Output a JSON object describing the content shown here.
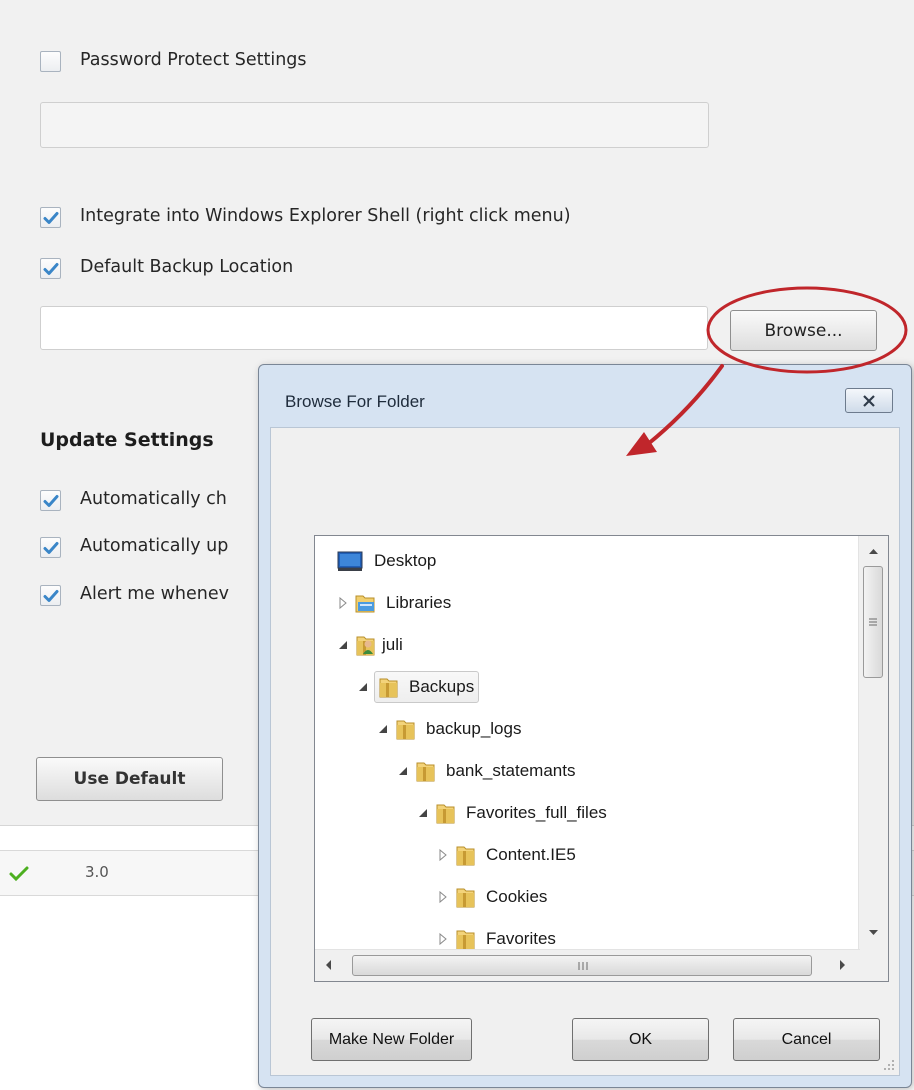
{
  "settings": {
    "password_protect_label": "Password Protect Settings",
    "integrate_shell_label": "Integrate into Windows Explorer Shell (right click menu)",
    "default_backup_label": "Default Backup Location",
    "browse_button": "Browse...",
    "update_heading": "Update Settings",
    "auto_check_label": "Automatically ch",
    "auto_update_label": "Automatically up",
    "alert_label": "Alert me whenev",
    "use_default_button": "Use Default",
    "checkboxes": {
      "password_protect": false,
      "integrate_shell": true,
      "default_backup": true,
      "auto_check": true,
      "auto_update": true,
      "alert": true
    }
  },
  "status_bar": {
    "version": "3.0"
  },
  "dialog": {
    "title": "Browse For Folder",
    "tree": [
      {
        "label": "Desktop",
        "icon": "desktop-icon",
        "expander": "none"
      },
      {
        "label": "Libraries",
        "icon": "libraries-icon",
        "expander": "collapsed"
      },
      {
        "label": "juli",
        "icon": "user-folder-icon",
        "expander": "expanded"
      },
      {
        "label": "Backups",
        "icon": "folder-icon",
        "expander": "expanded",
        "selected": true
      },
      {
        "label": "backup_logs",
        "icon": "folder-icon",
        "expander": "expanded"
      },
      {
        "label": "bank_statemants",
        "icon": "folder-icon",
        "expander": "expanded"
      },
      {
        "label": "Favorites_full_files",
        "icon": "folder-icon",
        "expander": "expanded"
      },
      {
        "label": "Content.IE5",
        "icon": "folder-icon",
        "expander": "collapsed"
      },
      {
        "label": "Cookies",
        "icon": "folder-icon",
        "expander": "collapsed"
      },
      {
        "label": "Favorites",
        "icon": "folder-icon",
        "expander": "collapsed"
      }
    ],
    "make_new_folder_button": "Make New Folder",
    "ok_button": "OK",
    "cancel_button": "Cancel"
  },
  "colors": {
    "checkbox_check": "#3a86c8",
    "annotation": "#c0262b",
    "status_check": "#4caf1f",
    "folder": "#e7c35a"
  }
}
